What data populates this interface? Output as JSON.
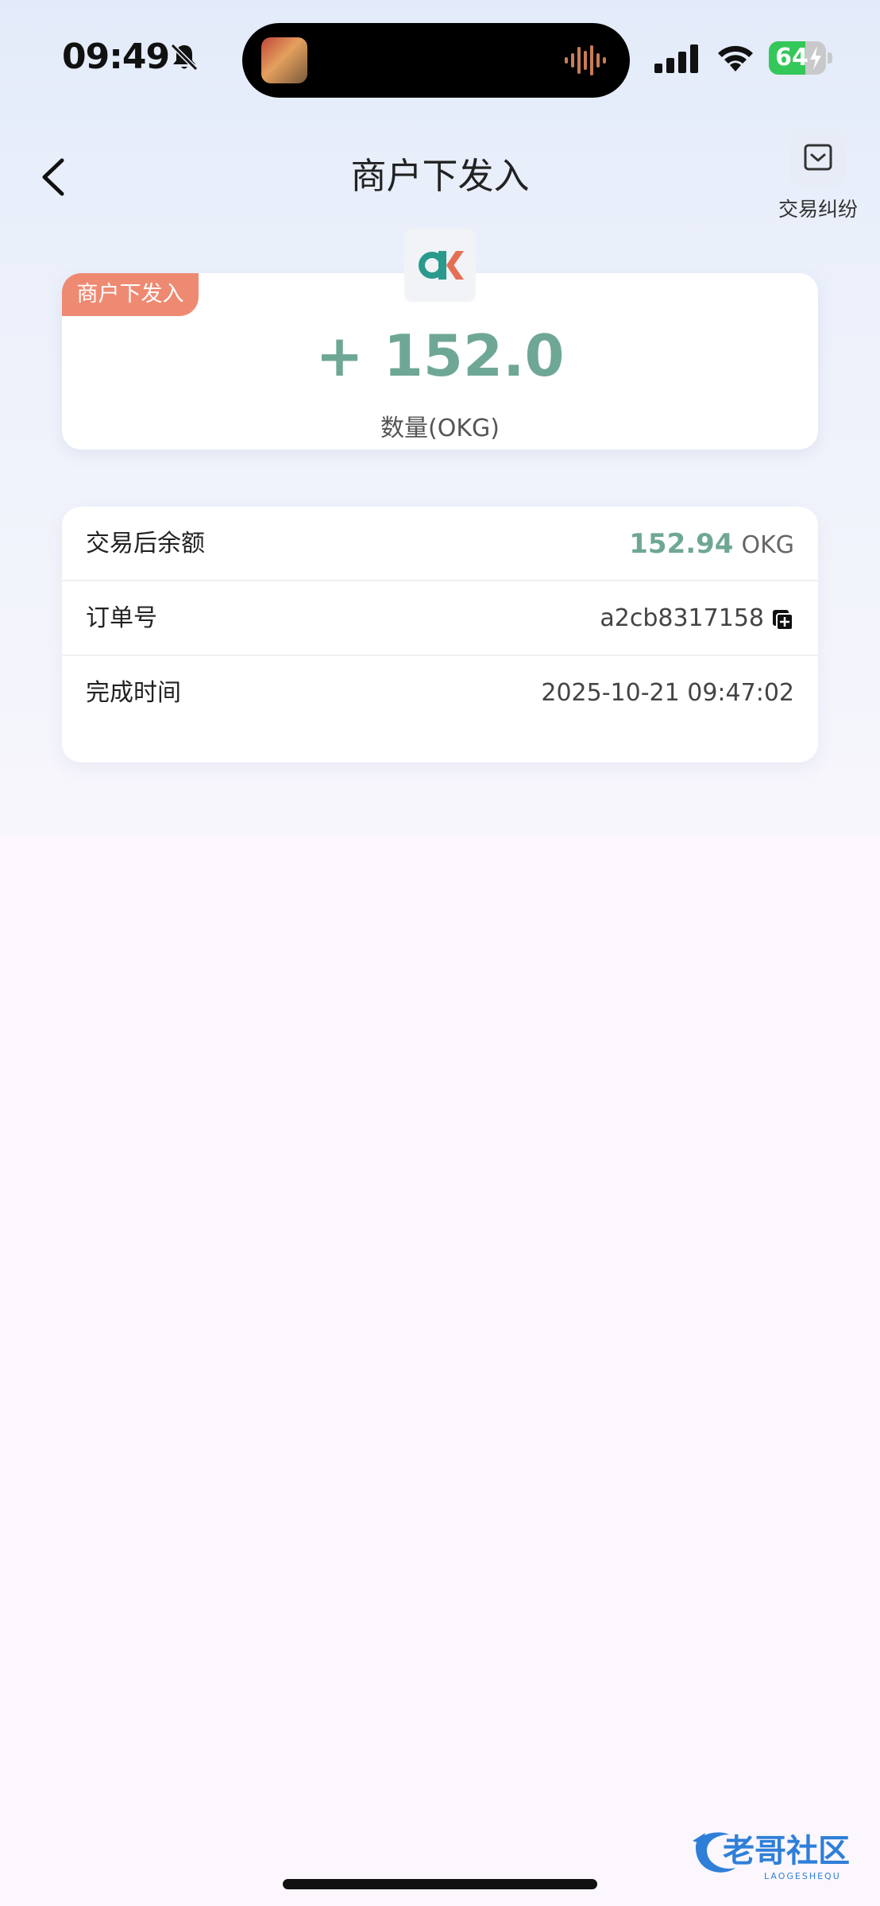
{
  "status_bar": {
    "time": "09:49",
    "battery": {
      "level_percent": 64,
      "text": "64"
    },
    "icons": [
      "bell-slash-icon",
      "signal-icon",
      "wifi-icon",
      "battery-charging-icon"
    ]
  },
  "header": {
    "title": "商户下发入",
    "back_icon": "chevron-left-icon",
    "dispute_label": "交易纠纷",
    "dispute_icon": "mail-down-icon"
  },
  "amount_card": {
    "tag": "商户下发入",
    "amount": "+ 152.0",
    "unit_label": "数量(OKG)",
    "logo": "ok-logo-icon"
  },
  "details": {
    "rows": [
      {
        "label": "交易后余额",
        "value": "152.94",
        "unit": "OKG"
      },
      {
        "label": "订单号",
        "value": "a2cb8317158",
        "icon": "copy-icon"
      },
      {
        "label": "完成时间",
        "value": "2025-10-21 09:47:02"
      }
    ]
  },
  "watermark": {
    "text": "老哥社区",
    "subtext": "LAOGESHEQU"
  },
  "colors": {
    "accent_green": "#6fa796",
    "tag_orange": "#ee8a72",
    "battery_green": "#34c759"
  }
}
